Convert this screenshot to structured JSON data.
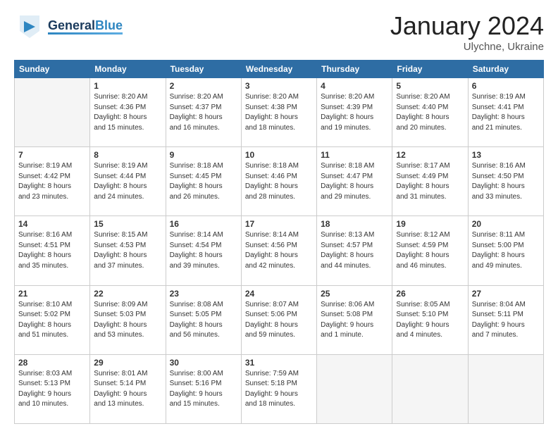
{
  "header": {
    "logo_general": "General",
    "logo_blue": "Blue",
    "title": "January 2024",
    "location": "Ulychne, Ukraine"
  },
  "columns": [
    "Sunday",
    "Monday",
    "Tuesday",
    "Wednesday",
    "Thursday",
    "Friday",
    "Saturday"
  ],
  "weeks": [
    [
      {
        "day": "",
        "info": ""
      },
      {
        "day": "1",
        "info": "Sunrise: 8:20 AM\nSunset: 4:36 PM\nDaylight: 8 hours\nand 15 minutes."
      },
      {
        "day": "2",
        "info": "Sunrise: 8:20 AM\nSunset: 4:37 PM\nDaylight: 8 hours\nand 16 minutes."
      },
      {
        "day": "3",
        "info": "Sunrise: 8:20 AM\nSunset: 4:38 PM\nDaylight: 8 hours\nand 18 minutes."
      },
      {
        "day": "4",
        "info": "Sunrise: 8:20 AM\nSunset: 4:39 PM\nDaylight: 8 hours\nand 19 minutes."
      },
      {
        "day": "5",
        "info": "Sunrise: 8:20 AM\nSunset: 4:40 PM\nDaylight: 8 hours\nand 20 minutes."
      },
      {
        "day": "6",
        "info": "Sunrise: 8:19 AM\nSunset: 4:41 PM\nDaylight: 8 hours\nand 21 minutes."
      }
    ],
    [
      {
        "day": "7",
        "info": "Sunrise: 8:19 AM\nSunset: 4:42 PM\nDaylight: 8 hours\nand 23 minutes."
      },
      {
        "day": "8",
        "info": "Sunrise: 8:19 AM\nSunset: 4:44 PM\nDaylight: 8 hours\nand 24 minutes."
      },
      {
        "day": "9",
        "info": "Sunrise: 8:18 AM\nSunset: 4:45 PM\nDaylight: 8 hours\nand 26 minutes."
      },
      {
        "day": "10",
        "info": "Sunrise: 8:18 AM\nSunset: 4:46 PM\nDaylight: 8 hours\nand 28 minutes."
      },
      {
        "day": "11",
        "info": "Sunrise: 8:18 AM\nSunset: 4:47 PM\nDaylight: 8 hours\nand 29 minutes."
      },
      {
        "day": "12",
        "info": "Sunrise: 8:17 AM\nSunset: 4:49 PM\nDaylight: 8 hours\nand 31 minutes."
      },
      {
        "day": "13",
        "info": "Sunrise: 8:16 AM\nSunset: 4:50 PM\nDaylight: 8 hours\nand 33 minutes."
      }
    ],
    [
      {
        "day": "14",
        "info": "Sunrise: 8:16 AM\nSunset: 4:51 PM\nDaylight: 8 hours\nand 35 minutes."
      },
      {
        "day": "15",
        "info": "Sunrise: 8:15 AM\nSunset: 4:53 PM\nDaylight: 8 hours\nand 37 minutes."
      },
      {
        "day": "16",
        "info": "Sunrise: 8:14 AM\nSunset: 4:54 PM\nDaylight: 8 hours\nand 39 minutes."
      },
      {
        "day": "17",
        "info": "Sunrise: 8:14 AM\nSunset: 4:56 PM\nDaylight: 8 hours\nand 42 minutes."
      },
      {
        "day": "18",
        "info": "Sunrise: 8:13 AM\nSunset: 4:57 PM\nDaylight: 8 hours\nand 44 minutes."
      },
      {
        "day": "19",
        "info": "Sunrise: 8:12 AM\nSunset: 4:59 PM\nDaylight: 8 hours\nand 46 minutes."
      },
      {
        "day": "20",
        "info": "Sunrise: 8:11 AM\nSunset: 5:00 PM\nDaylight: 8 hours\nand 49 minutes."
      }
    ],
    [
      {
        "day": "21",
        "info": "Sunrise: 8:10 AM\nSunset: 5:02 PM\nDaylight: 8 hours\nand 51 minutes."
      },
      {
        "day": "22",
        "info": "Sunrise: 8:09 AM\nSunset: 5:03 PM\nDaylight: 8 hours\nand 53 minutes."
      },
      {
        "day": "23",
        "info": "Sunrise: 8:08 AM\nSunset: 5:05 PM\nDaylight: 8 hours\nand 56 minutes."
      },
      {
        "day": "24",
        "info": "Sunrise: 8:07 AM\nSunset: 5:06 PM\nDaylight: 8 hours\nand 59 minutes."
      },
      {
        "day": "25",
        "info": "Sunrise: 8:06 AM\nSunset: 5:08 PM\nDaylight: 9 hours\nand 1 minute."
      },
      {
        "day": "26",
        "info": "Sunrise: 8:05 AM\nSunset: 5:10 PM\nDaylight: 9 hours\nand 4 minutes."
      },
      {
        "day": "27",
        "info": "Sunrise: 8:04 AM\nSunset: 5:11 PM\nDaylight: 9 hours\nand 7 minutes."
      }
    ],
    [
      {
        "day": "28",
        "info": "Sunrise: 8:03 AM\nSunset: 5:13 PM\nDaylight: 9 hours\nand 10 minutes."
      },
      {
        "day": "29",
        "info": "Sunrise: 8:01 AM\nSunset: 5:14 PM\nDaylight: 9 hours\nand 13 minutes."
      },
      {
        "day": "30",
        "info": "Sunrise: 8:00 AM\nSunset: 5:16 PM\nDaylight: 9 hours\nand 15 minutes."
      },
      {
        "day": "31",
        "info": "Sunrise: 7:59 AM\nSunset: 5:18 PM\nDaylight: 9 hours\nand 18 minutes."
      },
      {
        "day": "",
        "info": ""
      },
      {
        "day": "",
        "info": ""
      },
      {
        "day": "",
        "info": ""
      }
    ]
  ]
}
